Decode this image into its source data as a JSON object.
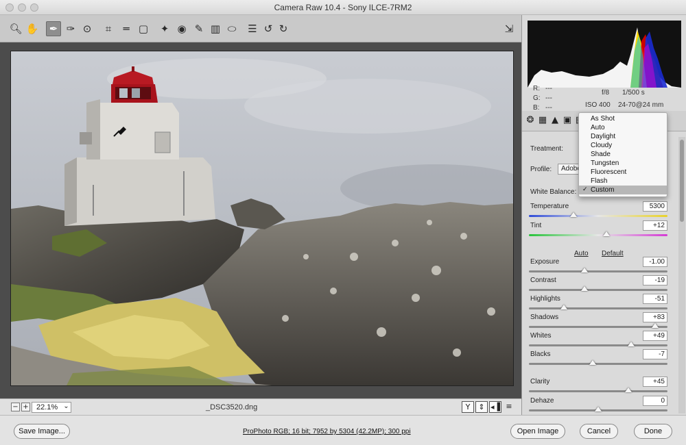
{
  "window": {
    "title": "Camera Raw 10.4 - Sony ILCE-7RM2"
  },
  "toolbar": {
    "tools": [
      "zoom-tool-icon",
      "hand-tool-icon",
      "white-balance-tool-icon",
      "color-sampler-icon",
      "targeted-adjustment-icon",
      "crop-tool-icon",
      "straighten-tool-icon",
      "transform-tool-icon",
      "spot-removal-icon",
      "red-eye-icon",
      "adjustment-brush-icon",
      "graduated-filter-icon",
      "radial-filter-icon",
      "preferences-icon",
      "rotate-ccw-icon",
      "rotate-cw-icon",
      "fullscreen-icon"
    ],
    "active_tool": "white-balance-tool-icon"
  },
  "preview": {
    "zoom": "22.1%",
    "filename": "_DSC3520.dng",
    "view_buttons": [
      "Y",
      "⇕",
      "◂▐",
      "≡"
    ]
  },
  "histogram": {
    "rgb_labels": {
      "r": "R:",
      "g": "G:",
      "b": "B:"
    },
    "rgb_values": {
      "r": "---",
      "g": "---",
      "b": "---"
    },
    "aperture": "f/8",
    "shutter": "1/500 s",
    "iso": "ISO 400",
    "lens": "24-70@24 mm"
  },
  "basic": {
    "treatment_label": "Treatment:",
    "profile_label": "Profile:",
    "profile_value": "Adobe",
    "white_balance_label": "White Balance:",
    "auto_link": "Auto",
    "default_link": "Default",
    "sliders": [
      {
        "label": "Temperature",
        "value": "5300",
        "position": 0.32
      },
      {
        "label": "Tint",
        "value": "+12",
        "position": 0.56
      },
      {
        "label": "Exposure",
        "value": "-1.00",
        "position": 0.4
      },
      {
        "label": "Contrast",
        "value": "-19",
        "position": 0.4
      },
      {
        "label": "Highlights",
        "value": "-51",
        "position": 0.25
      },
      {
        "label": "Shadows",
        "value": "+83",
        "position": 0.91
      },
      {
        "label": "Whites",
        "value": "+49",
        "position": 0.74
      },
      {
        "label": "Blacks",
        "value": "-7",
        "position": 0.46
      },
      {
        "label": "Clarity",
        "value": "+45",
        "position": 0.72
      },
      {
        "label": "Dehaze",
        "value": "0",
        "position": 0.5
      }
    ]
  },
  "white_balance_menu": {
    "options": [
      "As Shot",
      "Auto",
      "Daylight",
      "Cloudy",
      "Shade",
      "Tungsten",
      "Fluorescent",
      "Flash",
      "Custom"
    ],
    "selected": "Custom"
  },
  "bottom": {
    "save_image": "Save Image...",
    "workflow": "ProPhoto RGB; 16 bit; 7952 by 5304 (42.2MP); 300 ppi",
    "open_image": "Open Image",
    "cancel": "Cancel",
    "done": "Done"
  }
}
